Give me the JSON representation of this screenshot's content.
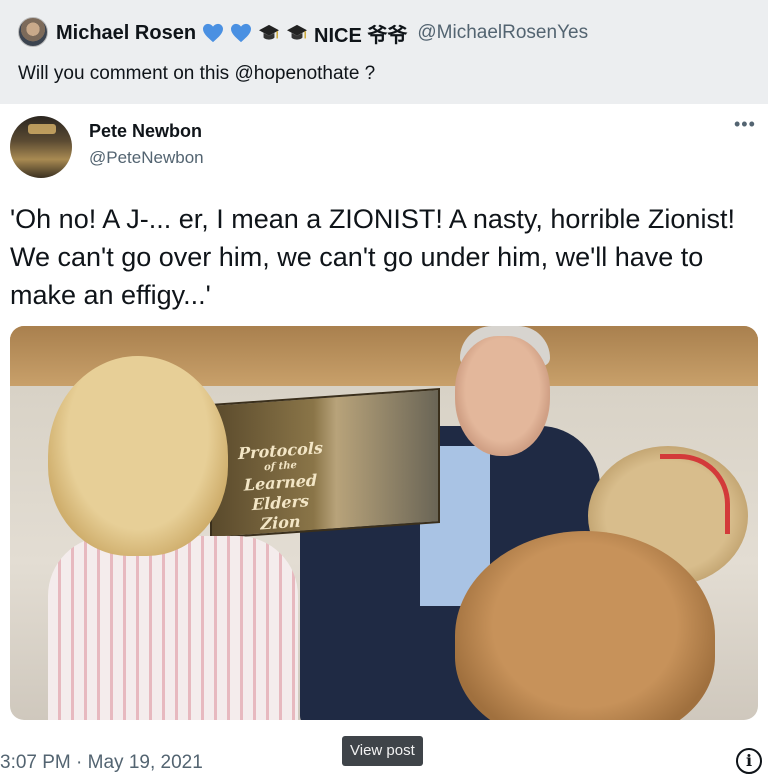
{
  "retweeter": {
    "name": "Michael Rosen",
    "badge_text": "NICE 爷爷",
    "handle": "@MichaelRosenYes",
    "comment": "Will you comment on this @hopenothate ?",
    "emoji_icons": [
      "blue-heart-icon",
      "blue-heart-icon",
      "graduation-cap-icon",
      "graduation-cap-icon"
    ]
  },
  "tweet": {
    "author_name": "Pete Newbon",
    "author_handle": "@PeteNewbon",
    "more_label": "•••",
    "text": "'Oh no! A J-... er, I mean a ZIONIST! A nasty, horrible Zionist! We can't go over him, we can't go under him, we'll have to make an effigy...'",
    "photo": {
      "book_title": "Protocols",
      "book_subtitle": "of the",
      "book_title_2": "Learned Elders",
      "book_title_3": "Zion"
    },
    "timestamp": "3:07 PM · May 19, 2021"
  },
  "footer": {
    "view_post_label": "View post",
    "info_label": "i"
  },
  "colors": {
    "heart": "#4a90e2",
    "handle_gray": "#536471",
    "header_bg": "#eceef0"
  }
}
